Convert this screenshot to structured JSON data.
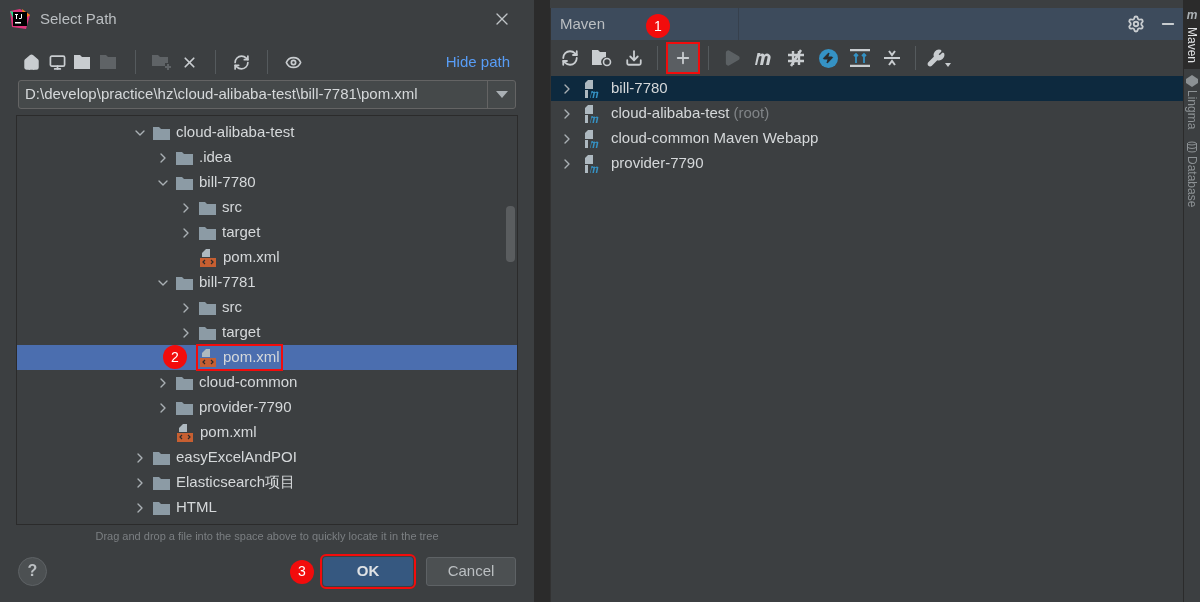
{
  "dialog": {
    "title": "Select Path",
    "toolbar": [
      {
        "kind": "home",
        "disabled": false
      },
      {
        "kind": "desktop",
        "disabled": false
      },
      {
        "kind": "project",
        "disabled": false
      },
      {
        "kind": "module",
        "disabled": true
      },
      {
        "kind": "sep"
      },
      {
        "kind": "new-folder",
        "disabled": true
      },
      {
        "kind": "delete",
        "disabled": false
      },
      {
        "kind": "sep"
      },
      {
        "kind": "refresh",
        "disabled": false
      },
      {
        "kind": "sep"
      },
      {
        "kind": "hidden",
        "disabled": false
      }
    ],
    "hide_path": "Hide path",
    "path": "D:\\develop\\practice\\hz\\cloud-alibaba-test\\bill-7781\\pom.xml",
    "tree": [
      {
        "label": "cloud-alibaba-test",
        "kind": "folder",
        "expanded": true,
        "selected": false,
        "children": [
          {
            "label": ".idea",
            "kind": "folder",
            "expanded": false,
            "selected": false
          },
          {
            "label": "bill-7780",
            "kind": "folder",
            "expanded": true,
            "selected": false,
            "children": [
              {
                "label": "src",
                "kind": "folder",
                "expanded": false,
                "selected": false
              },
              {
                "label": "target",
                "kind": "folder",
                "expanded": false,
                "selected": false
              },
              {
                "label": "pom.xml",
                "kind": "pom",
                "selected": false
              }
            ]
          },
          {
            "label": "bill-7781",
            "kind": "folder",
            "expanded": true,
            "selected": false,
            "children": [
              {
                "label": "src",
                "kind": "folder",
                "expanded": false,
                "selected": false
              },
              {
                "label": "target",
                "kind": "folder",
                "expanded": false,
                "selected": false
              },
              {
                "label": "pom.xml",
                "kind": "pom",
                "selected": true,
                "callout": "2"
              }
            ]
          },
          {
            "label": "cloud-common",
            "kind": "folder",
            "expanded": false,
            "selected": false
          },
          {
            "label": "provider-7790",
            "kind": "folder",
            "expanded": false,
            "selected": false
          },
          {
            "label": "pom.xml",
            "kind": "pom",
            "selected": false
          }
        ]
      },
      {
        "label": "easyExcelAndPOI",
        "kind": "folder",
        "expanded": false,
        "selected": false
      },
      {
        "label": "Elasticsearch项目",
        "kind": "folder",
        "expanded": false,
        "selected": false
      },
      {
        "label": "HTML",
        "kind": "folder",
        "expanded": false,
        "selected": false
      }
    ],
    "hint": "Drag and drop a file into the space above to quickly locate it in the tree",
    "help": "?",
    "ok": {
      "label": "OK",
      "callout": "3"
    },
    "cancel": {
      "label": "Cancel"
    }
  },
  "maven": {
    "title": "Maven",
    "toolbar": [
      {
        "kind": "reload",
        "disabled": false
      },
      {
        "kind": "folder-reload",
        "disabled": false
      },
      {
        "kind": "download",
        "disabled": false
      },
      {
        "kind": "sep"
      },
      {
        "kind": "add",
        "disabled": false,
        "callout": "1"
      },
      {
        "kind": "sep"
      },
      {
        "kind": "run",
        "disabled": true
      },
      {
        "kind": "m",
        "disabled": false
      },
      {
        "kind": "skip-tests",
        "disabled": false
      },
      {
        "kind": "offline",
        "disabled": false
      },
      {
        "kind": "show-deps",
        "disabled": false
      },
      {
        "kind": "collapse",
        "disabled": false
      },
      {
        "kind": "sep"
      },
      {
        "kind": "wrench",
        "disabled": false
      }
    ],
    "projects": [
      {
        "label": "bill-7780",
        "selected": true
      },
      {
        "label": "cloud-alibaba-test",
        "note": "(root)",
        "selected": false
      },
      {
        "label": "cloud-common Maven Webapp",
        "selected": false
      },
      {
        "label": "provider-7790",
        "selected": false
      }
    ]
  },
  "side_tabs": [
    {
      "label": "Maven",
      "kind": "maven",
      "selected": true
    },
    {
      "label": "Lingma",
      "kind": "lingma",
      "selected": false
    },
    {
      "label": "Database",
      "kind": "database",
      "selected": false
    }
  ]
}
